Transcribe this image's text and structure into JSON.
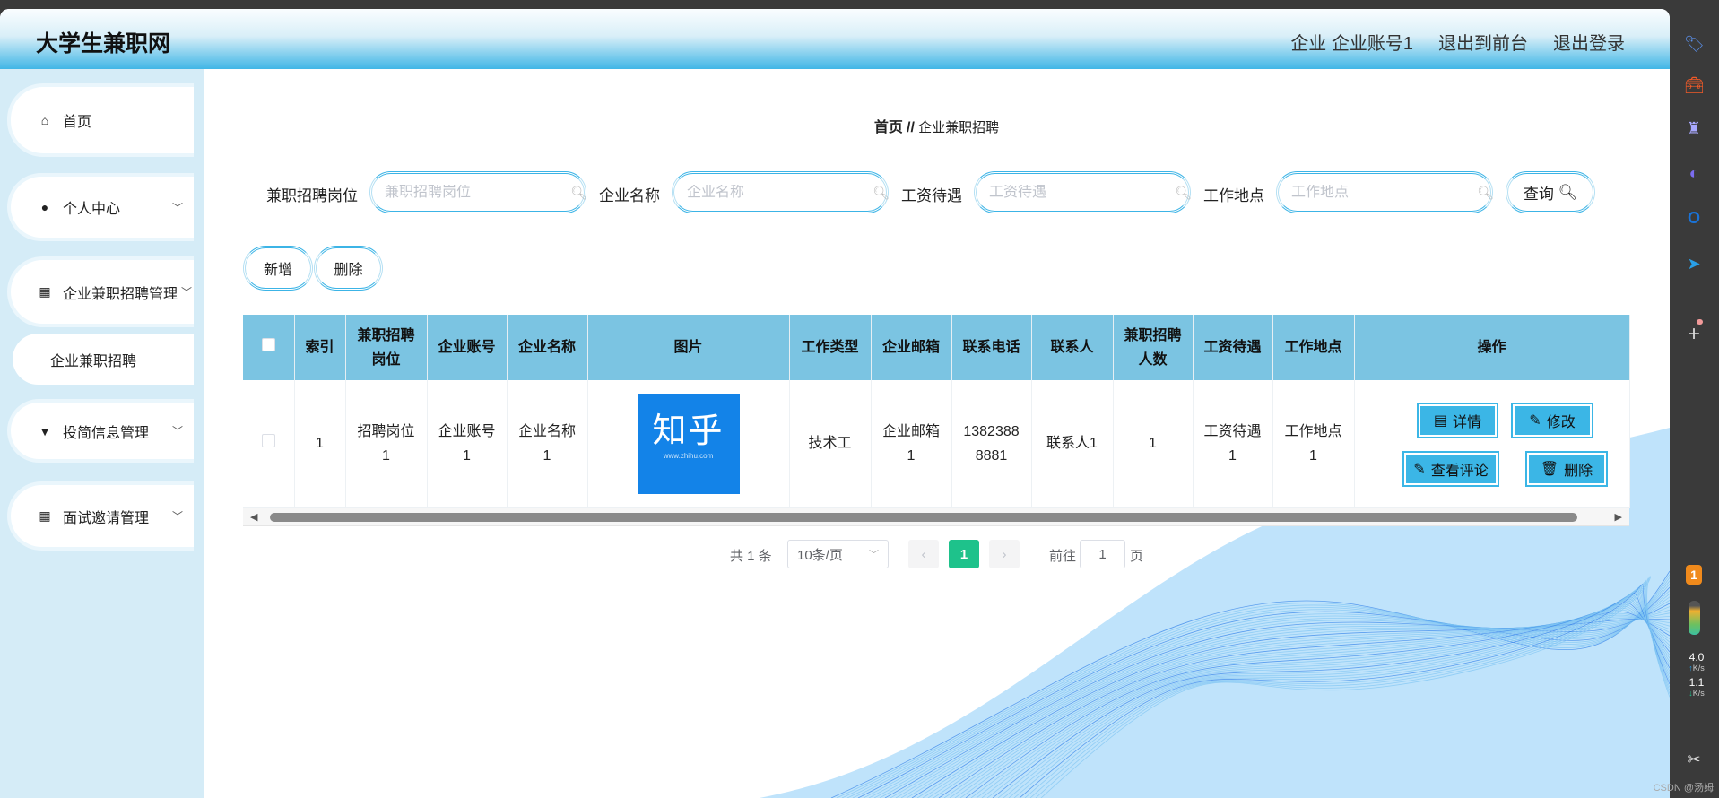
{
  "header": {
    "title": "大学生兼职网",
    "user": "企业 企业账号1",
    "to_front": "退出到前台",
    "logout": "退出登录"
  },
  "sidebar": {
    "items": [
      {
        "label": "首页",
        "icon": "home-icon"
      },
      {
        "label": "个人中心",
        "icon": "user-icon"
      },
      {
        "label": "企业兼职招聘管理",
        "icon": "grid-icon"
      },
      {
        "label": "投简信息管理",
        "icon": "pin-icon"
      },
      {
        "label": "面试邀请管理",
        "icon": "grid-icon"
      }
    ],
    "submenu": "企业兼职招聘"
  },
  "breadcrumb": {
    "home": "首页",
    "sep": "//",
    "current": "企业兼职招聘"
  },
  "search": {
    "fields": [
      {
        "label": "兼职招聘岗位",
        "placeholder": "兼职招聘岗位",
        "value": ""
      },
      {
        "label": "企业名称",
        "placeholder": "企业名称",
        "value": ""
      },
      {
        "label": "工资待遇",
        "placeholder": "工资待遇",
        "value": ""
      },
      {
        "label": "工作地点",
        "placeholder": "工作地点",
        "value": ""
      }
    ],
    "query": "查询"
  },
  "actions": {
    "add": "新增",
    "delete": "删除"
  },
  "table": {
    "headers": [
      "",
      "索引",
      "兼职招聘岗位",
      "企业账号",
      "企业名称",
      "图片",
      "工作类型",
      "企业邮箱",
      "联系电话",
      "联系人",
      "兼职招聘人数",
      "工资待遇",
      "工作地点",
      "操作"
    ],
    "rows": [
      {
        "index": "1",
        "post": "招聘岗位1",
        "account": "企业账号1",
        "name": "企业名称1",
        "image_text": "知乎",
        "image_sub": "www.zhihu.com",
        "type": "技术工",
        "email": "企业邮箱1",
        "phone": "13823888881",
        "contact": "联系人1",
        "count": "1",
        "salary": "工资待遇1",
        "location": "工作地点1"
      }
    ],
    "row_actions": {
      "detail": "详情",
      "edit": "修改",
      "comments": "查看评论",
      "delete": "删除"
    }
  },
  "pagination": {
    "total": "共 1 条",
    "page_size": "10条/页",
    "current": "1",
    "goto_label": "前往",
    "goto_value": "1",
    "page_suffix": "页"
  },
  "taskbar": {
    "up_speed": "4.0",
    "down_speed": "1.1",
    "unit": "K/s",
    "badge": "1",
    "watermark": "CSDN @汤姆"
  },
  "colors": {
    "accent": "#3bb6e6",
    "table_header": "#7bc4e2",
    "sidebar": "#d5ecf7",
    "page_active": "#1ec28b"
  }
}
